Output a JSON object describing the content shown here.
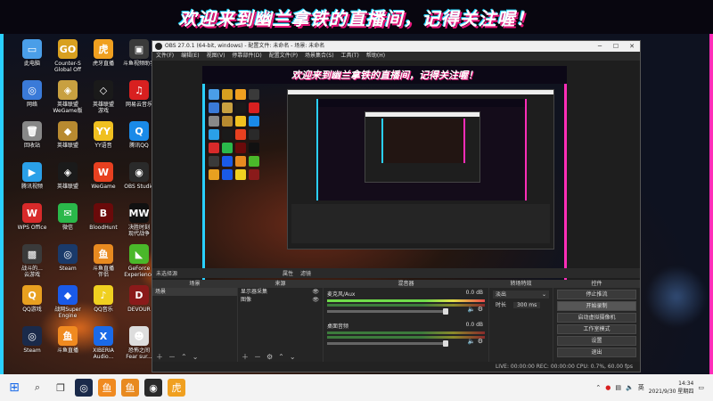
{
  "banner": {
    "text": "欢迎来到幽兰拿铁的直播间，记得关注喔！"
  },
  "desktop": {
    "icons": [
      {
        "label": "此电脑",
        "color": "#4a9ee8",
        "glyph": "▭"
      },
      {
        "label": "Counter-S\nGlobal Off",
        "color": "#d8a020",
        "glyph": "GO"
      },
      {
        "label": "虎牙直播",
        "color": "#f0a020",
        "glyph": "虎"
      },
      {
        "label": "斗鱼视频助手",
        "color": "#3a3a3a",
        "glyph": "▣"
      },
      {
        "label": "网络",
        "color": "#3a7ad8",
        "glyph": "◎"
      },
      {
        "label": "英雄联盟\nWeGame版",
        "color": "#c8a040",
        "glyph": "◈"
      },
      {
        "label": "英雄联盟\n游戏",
        "color": "#1a1a1a",
        "glyph": "◇"
      },
      {
        "label": "网易云音乐",
        "color": "#d82020",
        "glyph": "♫"
      },
      {
        "label": "回收站",
        "color": "#888",
        "glyph": "🗑"
      },
      {
        "label": "英雄联盟",
        "color": "#b88a30",
        "glyph": "◆"
      },
      {
        "label": "YY语音",
        "color": "#f0c020",
        "glyph": "YY"
      },
      {
        "label": "腾讯QQ",
        "color": "#1a8ae8",
        "glyph": "Q"
      },
      {
        "label": "腾讯视频",
        "color": "#2aa0e8",
        "glyph": "▶"
      },
      {
        "label": "英雄联盟",
        "color": "#1a1a1a",
        "glyph": "◈"
      },
      {
        "label": "WeGame",
        "color": "#e84020",
        "glyph": "W"
      },
      {
        "label": "OBS Studio",
        "color": "#2a2a2a",
        "glyph": "◉"
      },
      {
        "label": "WPS Office",
        "color": "#d82a2a",
        "glyph": "W"
      },
      {
        "label": "微信",
        "color": "#2ab84a",
        "glyph": "✉"
      },
      {
        "label": "BloodHunt",
        "color": "#6a0a0a",
        "glyph": "B"
      },
      {
        "label": "决胜时刻\n现代战争",
        "color": "#111",
        "glyph": "MW"
      },
      {
        "label": "战斗的...\n云游戏",
        "color": "#3a3a3a",
        "glyph": "▩"
      },
      {
        "label": "Steam",
        "color": "#1a3a6a",
        "glyph": "◎"
      },
      {
        "label": "斗鱼直播\n伴侣",
        "color": "#e88a20",
        "glyph": "鱼"
      },
      {
        "label": "GeForce\nExperience",
        "color": "#4ab82a",
        "glyph": "◣"
      },
      {
        "label": "QQ游戏",
        "color": "#e8a020",
        "glyph": "Q"
      },
      {
        "label": "战网Super\nEngine",
        "color": "#1a5ae8",
        "glyph": "◆"
      },
      {
        "label": "QQ音乐",
        "color": "#f0d020",
        "glyph": "♪"
      },
      {
        "label": "DEVOUR",
        "color": "#8a1a1a",
        "glyph": "D"
      },
      {
        "label": "Steam",
        "color": "#1a2a4a",
        "glyph": "◎"
      },
      {
        "label": "斗鱼直播",
        "color": "#f08a20",
        "glyph": "鱼"
      },
      {
        "label": "XIBERIA\nAudio...",
        "color": "#1a6ae8",
        "glyph": "X"
      },
      {
        "label": "恐怖之间\nFear sur...",
        "color": "#ddd",
        "glyph": "☻"
      }
    ]
  },
  "obs": {
    "title": "OBS 27.0.1 (64-bit, windows) - 配置文件: 未命名 - 场景: 未命名",
    "menu": [
      "文件(F)",
      "编辑(E)",
      "视图(V)",
      "停靠部件(D)",
      "配置文件(P)",
      "场景集合(S)",
      "工具(T)",
      "帮助(H)"
    ],
    "preview_banner": "欢迎来到幽兰拿铁的直播间，记得关注喔！",
    "source_bar": {
      "label": "未选择源",
      "props": "属性",
      "filters": "滤镜"
    },
    "scenes": {
      "header": "场景",
      "items": [
        "场景"
      ]
    },
    "sources": {
      "header": "来源",
      "items": [
        "显示器采集",
        "图像"
      ]
    },
    "mixer": {
      "header": "混音器",
      "tracks": [
        {
          "name": "麦克风/Aux",
          "db": "0.0 dB"
        },
        {
          "name": "桌面音频",
          "db": "0.0 dB"
        }
      ]
    },
    "transitions": {
      "header": "转场特效",
      "type": "淡出",
      "duration_label": "时长",
      "duration": "300 ms"
    },
    "controls": {
      "header": "控件",
      "buttons": [
        "停止推流",
        "开始录制",
        "启动虚拟摄像机",
        "工作室模式",
        "设置",
        "退出"
      ]
    },
    "status": "LIVE: 00:00:00   REC: 00:00:00   CPU: 0.7%, 60.00 fps"
  },
  "taskbar": {
    "tray_lang": "英",
    "time": "14:34",
    "date": "2021/9/30 星期四"
  }
}
